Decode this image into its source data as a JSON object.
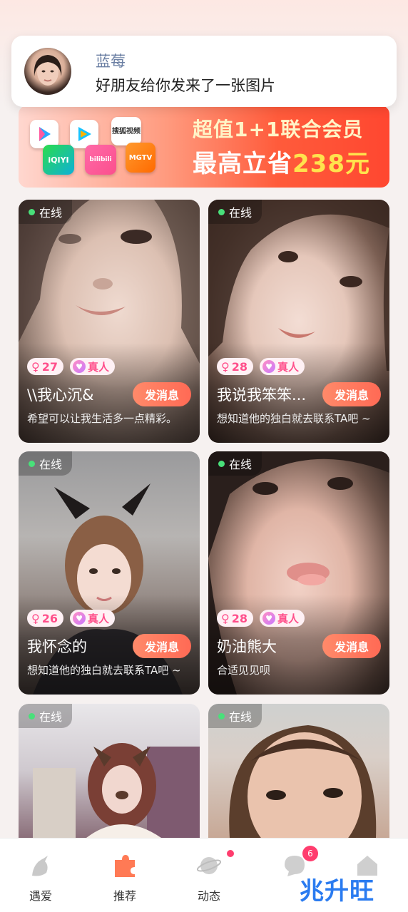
{
  "notification": {
    "sender": "蓝莓",
    "message": "好朋友给你发来了一张图片"
  },
  "banner": {
    "logos": [
      "iQIYI",
      "bilibili",
      "搜狐视频",
      "MGTV",
      "腾讯视频",
      "优酷"
    ],
    "line1": "超值1+1联合会员",
    "line2_prefix": "最高立省",
    "line2_highlight": "238元"
  },
  "cards": [
    {
      "online": "在线",
      "age": "27",
      "verified": "真人",
      "name": "\\\\我心沉&",
      "button": "发消息",
      "bio": "希望可以让我生活多一点精彩。"
    },
    {
      "online": "在线",
      "age": "28",
      "verified": "真人",
      "name": "我说我笨笨...",
      "button": "发消息",
      "bio": "想知道他的独白就去联系TA吧 ~"
    },
    {
      "online": "在线",
      "age": "26",
      "verified": "真人",
      "name": "我怀念的",
      "button": "发消息",
      "bio": "想知道他的独白就去联系TA吧 ~"
    },
    {
      "online": "在线",
      "age": "28",
      "verified": "真人",
      "name": "奶油熊大",
      "button": "发消息",
      "bio": "合适见见呗"
    },
    {
      "online": "在线"
    },
    {
      "online": "在线"
    }
  ],
  "tabs": [
    {
      "label": "遇爱",
      "icon": "sprout-icon"
    },
    {
      "label": "推荐",
      "icon": "puzzle-icon"
    },
    {
      "label": "动态",
      "icon": "planet-icon"
    },
    {
      "label": "",
      "icon": "chat-bubble-icon",
      "badge": "6"
    },
    {
      "label": "",
      "icon": "home-icon"
    }
  ],
  "watermark": "兆升旺",
  "colors": {
    "accent": "#ff6a55",
    "badge": "#ff3d6e",
    "online": "#49e07a"
  }
}
